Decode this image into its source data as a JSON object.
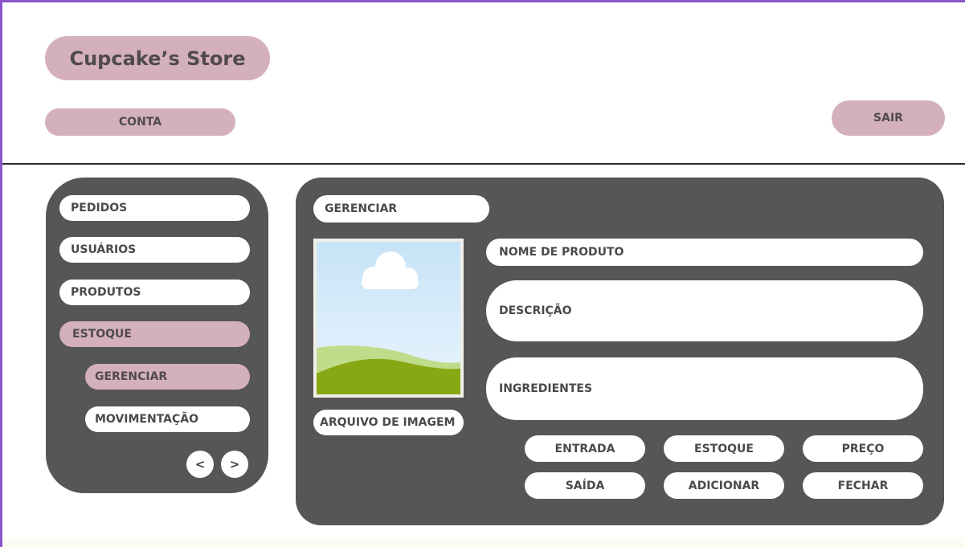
{
  "header": {
    "brand": "Cupcake’s Store",
    "account_label": "CONTA",
    "logout_label": "SAIR"
  },
  "sidebar": {
    "items": [
      {
        "label": "PEDIDOS"
      },
      {
        "label": "USUÁRIOS"
      },
      {
        "label": "PRODUTOS"
      },
      {
        "label": "ESTOQUE",
        "selected": true
      }
    ],
    "subitems": [
      {
        "label": "GERENCIAR",
        "selected": true
      },
      {
        "label": "MOVIMENTAÇÃO"
      }
    ],
    "prev_label": "<",
    "next_label": ">"
  },
  "main": {
    "tab_label": "GERENCIAR",
    "image_button_label": "ARQUIVO DE IMAGEM",
    "fields": {
      "name": "NOME DE PRODUTO",
      "description": "DESCRIÇÃO",
      "ingredients": "INGREDIENTES"
    },
    "actions": {
      "entrada": "ENTRADA",
      "estoque": "ESTOQUE",
      "preco": "PREÇO",
      "saida": "SAÍDA",
      "adicionar": "ADICIONAR",
      "fechar": "FECHAR"
    }
  },
  "colors": {
    "frame_border": "#8a55c8",
    "accent_pink": "#d4b0bb",
    "panel_gray": "#565656",
    "text_dark": "#4f4a4d"
  },
  "icons": {
    "image_placeholder": "landscape-image-icon"
  }
}
